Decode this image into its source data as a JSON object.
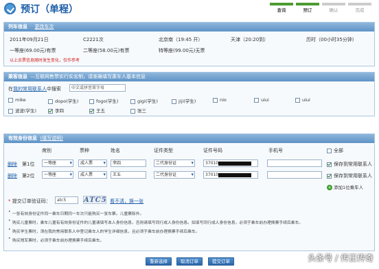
{
  "header": {
    "title": "预订（单程）"
  },
  "steps": [
    {
      "label": "查询",
      "state": "on"
    },
    {
      "label": "预订",
      "state": "on"
    },
    {
      "label": "确认",
      "state": "off"
    },
    {
      "label": "完成",
      "state": "off"
    }
  ],
  "train": {
    "section_title": "列车信息",
    "change_link": "更改车次",
    "date": "2011年09月21日",
    "train_no": "C2221次",
    "from": "北京南（19:45 开）",
    "to": "天津（20:20到）",
    "duration": "历时（00小时35分钟）",
    "fares": [
      "一等座(69.00元)有票",
      "二等座(58.00元)有票",
      "特等座(99.00元)无票"
    ],
    "notice": "以上余票信息随时发生变化，仅作参考"
  },
  "passengers": {
    "section_title": "乘客信息",
    "section_note": "—互联网售票实行实名制，请准确填写乘车人基本信息",
    "search_prefix": "在",
    "search_link": "我的常用联系人",
    "search_suffix": "中搜索",
    "search_placeholder": "中文或拼音首字母",
    "list": [
      {
        "name": "mike",
        "checked": false
      },
      {
        "name": "dopo(学生)",
        "checked": false
      },
      {
        "name": "fogo(学生)",
        "checked": false
      },
      {
        "name": "gigi(学生)",
        "checked": false
      },
      {
        "name": "jiji(学生)",
        "checked": false
      },
      {
        "name": "nio",
        "checked": false
      },
      {
        "name": "uiui",
        "checked": false
      },
      {
        "name": "uiui",
        "checked": false
      },
      {
        "name": "波波(学生)",
        "checked": false
      },
      {
        "name": "李四",
        "checked": true
      },
      {
        "name": "王五",
        "checked": true
      },
      {
        "name": "张三",
        "checked": false
      }
    ]
  },
  "identity": {
    "section_title": "有效身份信息",
    "help_link": "(填写说明)",
    "columns": {
      "seat": "席别",
      "ticket": "票种",
      "name": "姓名",
      "id_type": "证件类型",
      "id_no": "证件号码",
      "phone": "手机号",
      "all": "全部"
    },
    "rows": [
      {
        "delete": "删除",
        "seq": "第1位",
        "seat": "一等座",
        "ticket": "成人票",
        "name": "李四",
        "id_type": "二代身份证",
        "id_prefix": "37010",
        "phone": "",
        "save_label": "保存到常用联系人",
        "save_checked": true
      },
      {
        "delete": "删除",
        "seq": "第2位",
        "seat": "一等座",
        "ticket": "成人票",
        "name": "王五",
        "id_type": "二代身份证",
        "id_prefix": "37010",
        "phone": "",
        "save_label": "保存到常用联系人",
        "save_checked": true
      }
    ],
    "add_button": "添加1位乘车人"
  },
  "captcha": {
    "label": "提交订单验证码：",
    "value": "atc5",
    "image_text": "ATC5",
    "refresh_link": "看不清，换一张"
  },
  "notes": [
    "一张有效身份证件同一乘车日期同一车次只能购买一张车票。儿童票除外。",
    "购买儿童票时，乘车儿童有有效身份证件的儿童请填写本人身份信息，否则请填写同行成人身份信息。如填写同行成人身份信息，必须于乘车前办理换票手续后乘车。",
    "购买学生票时，须在我的常用联系人中登记乘车人的学生详细信息，且必须于乘车前办理换票手续后乘车。",
    "购买残军票时，必须于乘车前办理换票手续后乘车。"
  ],
  "buttons": {
    "reselect": "重新选择",
    "cancel": "取消订单",
    "submit": "提交订单"
  },
  "watermark": "头条号 / 传正传奇",
  "colors": {
    "accent": "#1d5ea8",
    "step_active": "#4a9b30",
    "warning": "#d02020"
  }
}
